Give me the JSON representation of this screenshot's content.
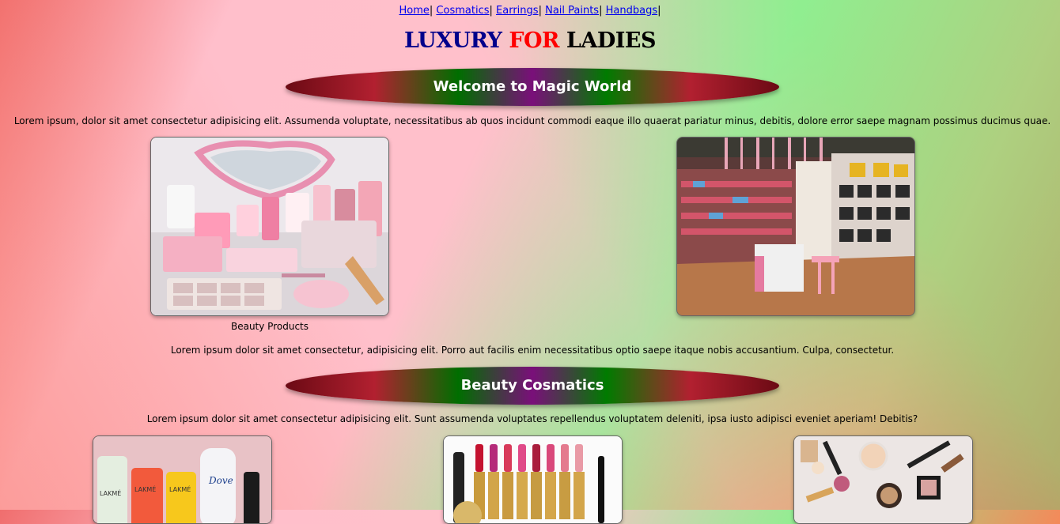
{
  "nav": {
    "links": [
      "Home",
      "Cosmatics",
      "Earrings",
      "Nail Paints",
      "Handbags"
    ],
    "separator": "|"
  },
  "header": {
    "title_word1": "LUXURY",
    "title_word2": "FOR",
    "title_word3": "LADIES"
  },
  "section1": {
    "heading": "Welcome to Magic World",
    "intro": "Lorem ipsum, dolor sit amet consectetur adipisicing elit. Assumenda voluptate, necessitatibus ab quos incidunt commodi eaque illo quaerat pariatur minus, debitis, dolore error saepe magnam possimus ducimus quae.",
    "images": [
      {
        "icon": "beauty-products-photo",
        "caption": "Beauty Products"
      },
      {
        "icon": "handbag-store-photo",
        "caption": ""
      }
    ],
    "outro": "Lorem ipsum dolor sit amet consectetur, adipisicing elit. Porro aut facilis enim necessitatibus optio saepe itaque nobis accusantium. Culpa, consectetur."
  },
  "section2": {
    "heading": "Beauty Cosmatics",
    "intro": "Lorem ipsum dolor sit amet consectetur adipisicing elit. Sunt assumenda voluptates repellendus voluptatem deleniti, ipsa iusto adipisci eveniet aperiam! Debitis?",
    "images": [
      {
        "icon": "skincare-products-photo"
      },
      {
        "icon": "lipsticks-photo"
      },
      {
        "icon": "makeup-flatlay-photo"
      }
    ]
  },
  "colors": {
    "title_blue": "#00008b",
    "title_red": "#ff0000",
    "link": "#0000ee",
    "banner_green": "#007b00",
    "banner_red": "#b22030",
    "banner_purple": "#7a0f7a"
  }
}
